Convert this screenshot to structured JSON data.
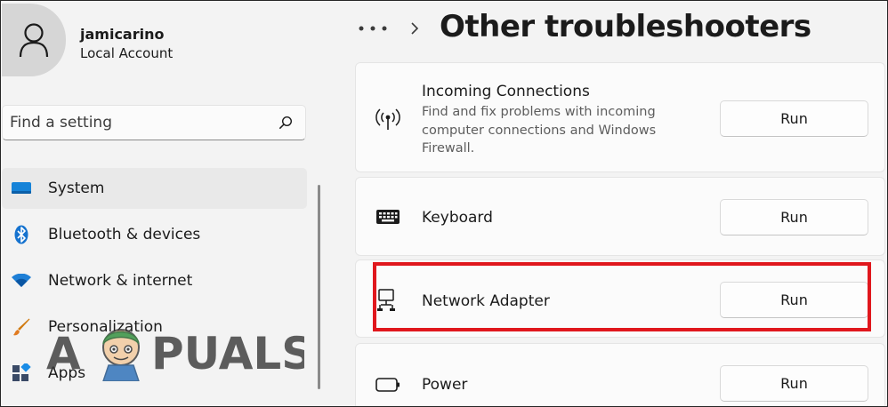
{
  "user": {
    "name": "jamicarino",
    "account_type": "Local Account"
  },
  "search": {
    "placeholder": "Find a setting"
  },
  "sidebar": {
    "items": [
      {
        "label": "System",
        "icon": "system-icon",
        "selected": true
      },
      {
        "label": "Bluetooth & devices",
        "icon": "bluetooth-icon"
      },
      {
        "label": "Network & internet",
        "icon": "wifi-icon"
      },
      {
        "label": "Personalization",
        "icon": "brush-icon"
      },
      {
        "label": "Apps",
        "icon": "apps-icon"
      }
    ]
  },
  "header": {
    "page_title": "Other troubleshooters"
  },
  "troubleshooters": [
    {
      "title": "Incoming Connections",
      "description": "Find and fix problems with incoming computer connections and Windows Firewall.",
      "icon": "broadcast-icon",
      "button": "Run"
    },
    {
      "title": "Keyboard",
      "icon": "keyboard-icon",
      "button": "Run"
    },
    {
      "title": "Network Adapter",
      "icon": "network-adapter-icon",
      "button": "Run",
      "highlighted": true
    },
    {
      "title": "Power",
      "icon": "battery-icon",
      "button": "Run"
    }
  ],
  "watermark": {
    "text": "APPUALS"
  },
  "colors": {
    "accent": "#0067c0",
    "highlight": "#e0171d",
    "background": "#f3f3f3",
    "card": "#fbfbfb"
  }
}
